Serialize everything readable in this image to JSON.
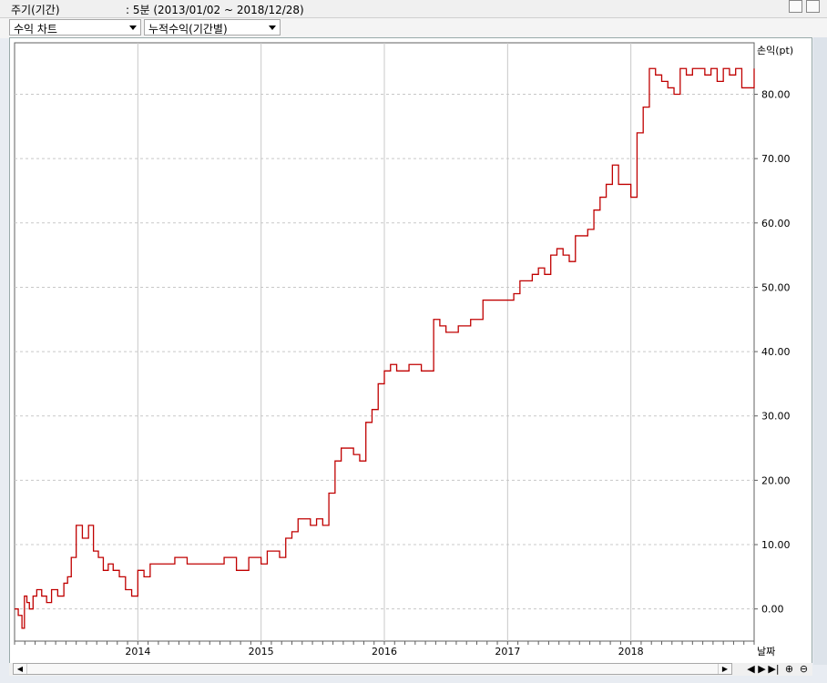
{
  "header": {
    "period_label": "주기(기간)",
    "period_value": ": 5분  (2013/01/02 ~ 2018/12/28)"
  },
  "toolbar": {
    "chart_select": "수익 차트",
    "mode_select": "누적수익(기간별)"
  },
  "colors": {
    "line": "#c00000",
    "grid": "#c8c8c8"
  },
  "icons": [
    "restore-icon",
    "close-icon",
    "scroll-left-icon",
    "scroll-right-icon",
    "nav-left-icon",
    "nav-right-icon",
    "nav-end-icon",
    "zoom-in-icon",
    "zoom-out-icon"
  ],
  "chart_data": {
    "type": "line",
    "xlabel": "날짜",
    "ylabel": "손익(pt)",
    "x_ticks": [
      "2014",
      "2015",
      "2016",
      "2017",
      "2018"
    ],
    "y_ticks": [
      "0.00",
      "10.00",
      "20.00",
      "30.00",
      "40.00",
      "50.00",
      "60.00",
      "70.00",
      "80.00"
    ],
    "ylim": [
      -5,
      88
    ],
    "xlim": [
      2013.0,
      2019.0
    ],
    "grid": true,
    "series": [
      {
        "x": [
          2013.0,
          2013.03,
          2013.06,
          2013.08,
          2013.1,
          2013.12,
          2013.15,
          2013.18,
          2013.22,
          2013.26,
          2013.3,
          2013.35,
          2013.4,
          2013.43,
          2013.46,
          2013.5,
          2013.55,
          2013.6,
          2013.64,
          2013.68,
          2013.72,
          2013.76,
          2013.8,
          2013.85,
          2013.9,
          2013.95,
          2014.0,
          2014.05,
          2014.1,
          2014.2,
          2014.3,
          2014.4,
          2014.5,
          2014.6,
          2014.7,
          2014.8,
          2014.9,
          2015.0,
          2015.05,
          2015.1,
          2015.15,
          2015.2,
          2015.25,
          2015.3,
          2015.4,
          2015.45,
          2015.5,
          2015.55,
          2015.6,
          2015.65,
          2015.7,
          2015.75,
          2015.8,
          2015.85,
          2015.9,
          2015.95,
          2016.0,
          2016.05,
          2016.1,
          2016.15,
          2016.2,
          2016.3,
          2016.4,
          2016.45,
          2016.5,
          2016.55,
          2016.6,
          2016.7,
          2016.8,
          2016.85,
          2016.9,
          2016.95,
          2017.0,
          2017.05,
          2017.1,
          2017.15,
          2017.2,
          2017.25,
          2017.3,
          2017.35,
          2017.4,
          2017.45,
          2017.5,
          2017.55,
          2017.6,
          2017.65,
          2017.7,
          2017.75,
          2017.8,
          2017.85,
          2017.9,
          2017.95,
          2018.0,
          2018.05,
          2018.1,
          2018.15,
          2018.2,
          2018.25,
          2018.3,
          2018.35,
          2018.4,
          2018.45,
          2018.5,
          2018.55,
          2018.6,
          2018.65,
          2018.7,
          2018.75,
          2018.8,
          2018.85,
          2018.9,
          2018.95,
          2019.0
        ],
        "y": [
          0,
          -1,
          -3,
          2,
          1,
          0,
          2,
          3,
          2,
          1,
          3,
          2,
          4,
          5,
          8,
          13,
          11,
          13,
          9,
          8,
          6,
          7,
          6,
          5,
          3,
          2,
          6,
          5,
          7,
          7,
          8,
          7,
          7,
          7,
          8,
          6,
          8,
          7,
          9,
          9,
          8,
          11,
          12,
          14,
          13,
          14,
          13,
          18,
          23,
          25,
          25,
          24,
          23,
          29,
          31,
          35,
          37,
          38,
          37,
          37,
          38,
          37,
          45,
          44,
          43,
          43,
          44,
          45,
          48,
          48,
          48,
          48,
          48,
          49,
          51,
          51,
          52,
          53,
          52,
          55,
          56,
          55,
          54,
          58,
          58,
          59,
          62,
          64,
          66,
          69,
          66,
          66,
          64,
          74,
          78,
          84,
          83,
          82,
          81,
          80,
          84,
          83,
          84,
          84,
          83,
          84,
          82,
          84,
          83,
          84,
          81,
          81,
          84
        ]
      }
    ]
  }
}
